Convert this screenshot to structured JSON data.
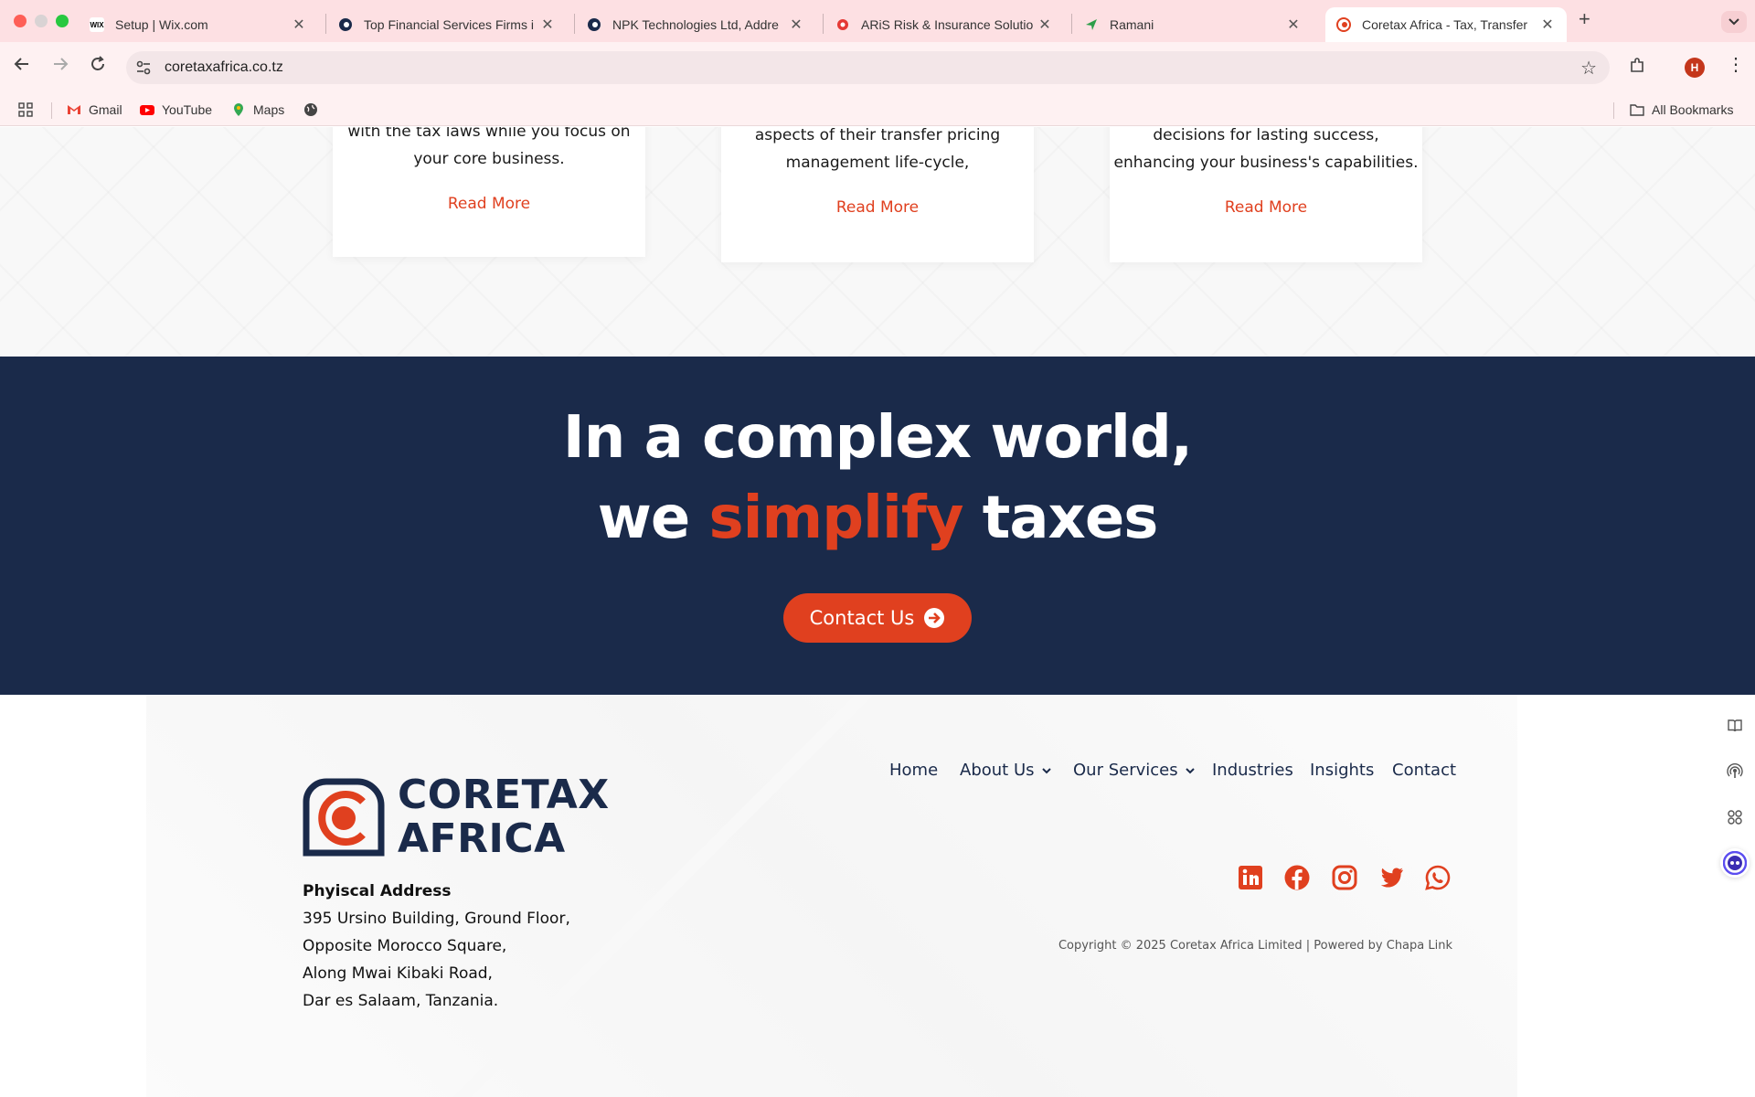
{
  "browser": {
    "tabs": [
      {
        "title": "Setup | Wix.com"
      },
      {
        "title": "Top Financial Services Firms i"
      },
      {
        "title": "NPK Technologies Ltd, Addre"
      },
      {
        "title": "ARiS Risk & Insurance Solutio"
      },
      {
        "title": "Ramani"
      },
      {
        "title": "Coretax Africa - Tax, Transfer"
      }
    ],
    "wix_favicon": "WIX",
    "url": "coretaxafrica.co.tz",
    "profile_initial": "H",
    "bookmarks": [
      "Gmail",
      "YouTube",
      "Maps"
    ],
    "all_bookmarks": "All Bookmarks"
  },
  "cards": [
    {
      "text_1": "with the tax laws while you focus on",
      "text_2": "your core business.",
      "link": "Read More"
    },
    {
      "text_1": "aspects of their transfer pricing",
      "text_2": "management life-cycle,",
      "link": "Read More"
    },
    {
      "text_1": "decisions for lasting success,",
      "text_2": "enhancing your business's capabilities.",
      "link": "Read More"
    }
  ],
  "banner": {
    "line1": "In a complex world,",
    "line2_pre": "we ",
    "line2_accent": "simplify",
    "line2_post": " taxes",
    "cta": "Contact Us"
  },
  "footer": {
    "logo_line1": "CORETAX",
    "logo_line2": "AFRICA",
    "address_title": "Phyiscal Address",
    "address_lines": [
      "395 Ursino Building, Ground Floor,",
      "Opposite Morocco Square,",
      "Along Mwai Kibaki Road,",
      "Dar es Salaam, Tanzania."
    ],
    "nav": [
      "Home",
      "About Us",
      "Our Services",
      "Industries",
      "Insights",
      "Contact"
    ],
    "social": [
      "linkedin-icon",
      "facebook-icon",
      "instagram-icon",
      "twitter-icon",
      "whatsapp-icon"
    ],
    "copyright": "Copyright © 2025 Coretax Africa Limited | Powered by Chapa Link"
  },
  "colors": {
    "navy": "#1a2a4a",
    "accent": "#e0401f",
    "tabbar": "#fde0e3"
  }
}
